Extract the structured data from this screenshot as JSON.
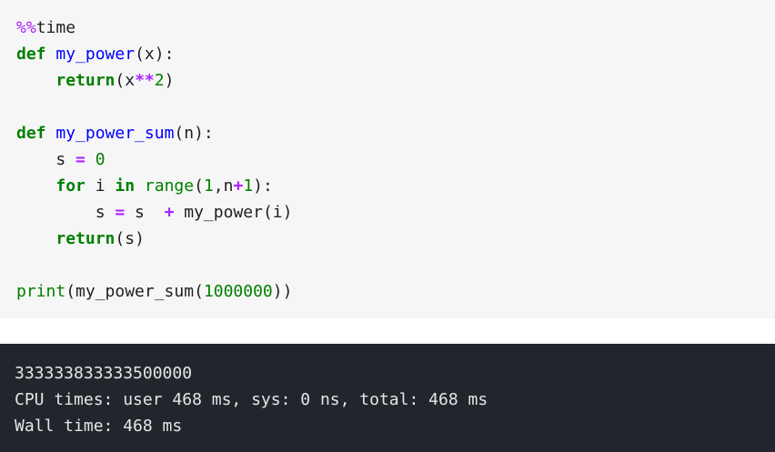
{
  "code_cell": {
    "lines": [
      [
        {
          "t": "%%",
          "c": "magic"
        },
        {
          "t": "time",
          "c": "txt"
        }
      ],
      [
        {
          "t": "def",
          "c": "kw"
        },
        {
          "t": " ",
          "c": "txt"
        },
        {
          "t": "my_power",
          "c": "fn"
        },
        {
          "t": "(x):",
          "c": "txt"
        }
      ],
      [
        {
          "t": "    ",
          "c": "txt"
        },
        {
          "t": "return",
          "c": "kw"
        },
        {
          "t": "(x",
          "c": "txt"
        },
        {
          "t": "**",
          "c": "op"
        },
        {
          "t": "2",
          "c": "num"
        },
        {
          "t": ")",
          "c": "txt"
        }
      ],
      [
        {
          "t": "",
          "c": "txt"
        }
      ],
      [
        {
          "t": "def",
          "c": "kw"
        },
        {
          "t": " ",
          "c": "txt"
        },
        {
          "t": "my_power_sum",
          "c": "fn"
        },
        {
          "t": "(n):",
          "c": "txt"
        }
      ],
      [
        {
          "t": "    s ",
          "c": "txt"
        },
        {
          "t": "=",
          "c": "op"
        },
        {
          "t": " ",
          "c": "txt"
        },
        {
          "t": "0",
          "c": "num"
        }
      ],
      [
        {
          "t": "    ",
          "c": "txt"
        },
        {
          "t": "for",
          "c": "kw"
        },
        {
          "t": " i ",
          "c": "txt"
        },
        {
          "t": "in",
          "c": "kw"
        },
        {
          "t": " ",
          "c": "txt"
        },
        {
          "t": "range",
          "c": "bi"
        },
        {
          "t": "(",
          "c": "txt"
        },
        {
          "t": "1",
          "c": "num"
        },
        {
          "t": ",n",
          "c": "txt"
        },
        {
          "t": "+",
          "c": "op"
        },
        {
          "t": "1",
          "c": "num"
        },
        {
          "t": "):",
          "c": "txt"
        }
      ],
      [
        {
          "t": "        s ",
          "c": "txt"
        },
        {
          "t": "=",
          "c": "op"
        },
        {
          "t": " s  ",
          "c": "txt"
        },
        {
          "t": "+",
          "c": "op"
        },
        {
          "t": " my_power(i)",
          "c": "txt"
        }
      ],
      [
        {
          "t": "    ",
          "c": "txt"
        },
        {
          "t": "return",
          "c": "kw"
        },
        {
          "t": "(s)",
          "c": "txt"
        }
      ],
      [
        {
          "t": "",
          "c": "txt"
        }
      ],
      [
        {
          "t": "print",
          "c": "bi"
        },
        {
          "t": "(my_power_sum(",
          "c": "txt"
        },
        {
          "t": "1000000",
          "c": "num"
        },
        {
          "t": "))",
          "c": "txt"
        }
      ]
    ]
  },
  "output_cell": {
    "lines": [
      "333333833333500000",
      "CPU times: user 468 ms, sys: 0 ns, total: 468 ms",
      "Wall time: 468 ms"
    ]
  },
  "colors": {
    "code_background": "#f6f6f6",
    "output_background": "#22252c",
    "keyword": "#008000",
    "function_name": "#0000ff",
    "operator": "#aa22ff",
    "number": "#008000"
  }
}
